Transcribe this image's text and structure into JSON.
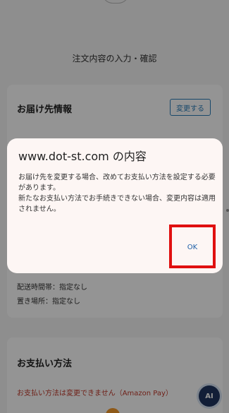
{
  "page": {
    "title": "注文内容の入力・確認"
  },
  "shipping": {
    "title": "お届け先情報",
    "change_button": "変更する",
    "lines": [
      "配送時間帯：指定なし",
      "置き場所：指定なし"
    ]
  },
  "payment": {
    "title": "お支払い方法",
    "note": "お支払い方法は変更できません（Amazon Pay）"
  },
  "ai_badge": {
    "label": "AI"
  },
  "dialog": {
    "title": "www.dot-st.com の内容",
    "message": [
      "お届け先を変更する場合、改めてお支払い方法を設定する必要があります。",
      "新たなお支払い方法でお手続きできない場合、変更内容は適用されません。"
    ],
    "ok_label": "OK"
  },
  "colors": {
    "highlight": "#e01010",
    "link_blue": "#2a7db8",
    "warning_red": "#c0392b"
  }
}
